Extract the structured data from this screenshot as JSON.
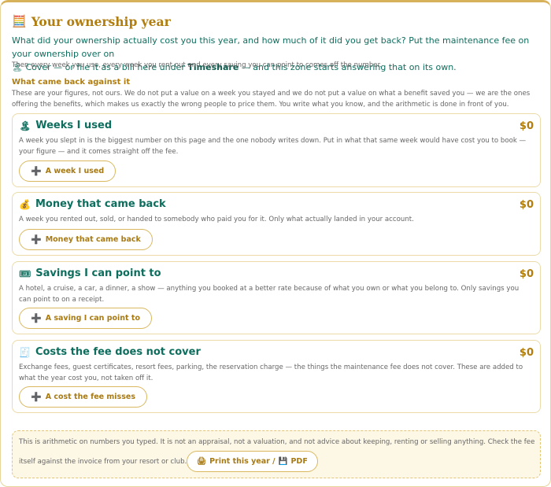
{
  "header": {
    "icon": "abacus-icon",
    "icon_glyph": "🧮",
    "title": "Your ownership year",
    "lead_part1": "What did your ownership actually cost you this year, and how much of it did you get back? Put the maintenance fee on your ownership over on",
    "lead_cover_icon": "🏝",
    "lead_part2": " Cover — or file it as a bill here under ",
    "lead_bold": "Timeshare",
    "lead_part3": " — and this zone starts answering that on its own.",
    "subtext": "Then every week you use, every week you rent out and every saving you can point to comes off the number."
  },
  "section": {
    "heading": "What came back against it",
    "description": "These are your figures, not ours. We do not put a value on a week you stayed and we do not put a value on what a benefit saved you — we are the ones offering the benefits, which makes us exactly the wrong people to price them. You write what you know, and the arithmetic is done in front of you."
  },
  "cards": [
    {
      "icon": "island-icon",
      "icon_glyph": "🏝",
      "title": "Weeks I used",
      "amount": "$0",
      "description": "A week you slept in is the biggest number on this page and the one nobody writes down. Put in what that same week would have cost you to book — your figure — and it comes straight off the fee.",
      "button": "A week I used"
    },
    {
      "icon": "money-bag-icon",
      "icon_glyph": "💰",
      "title": "Money that came back",
      "amount": "$0",
      "description": "A week you rented out, sold, or handed to somebody who paid you for it. Only what actually landed in your account.",
      "button": "Money that came back"
    },
    {
      "icon": "ticket-icon",
      "icon_glyph": "🎟",
      "title": "Savings I can point to",
      "amount": "$0",
      "description": "A hotel, a cruise, a car, a dinner, a show — anything you booked at a better rate because of what you own or what you belong to. Only savings you can point to on a receipt.",
      "button": "A saving I can point to"
    },
    {
      "icon": "receipt-icon",
      "icon_glyph": "🧾",
      "title": "Costs the fee does not cover",
      "amount": "$0",
      "description": "Exchange fees, guest certificates, resort fees, parking, the reservation charge — the things the maintenance fee does not cover. These are added to what the year cost you, not taken off it.",
      "button": "A cost the fee misses"
    }
  ],
  "plus_glyph": "➕",
  "footer": {
    "text_line1": "This is arithmetic on numbers you typed. It is not an appraisal, not a valuation, and not advice about keeping, renting or selling anything. Check the fee",
    "text_line2": "itself against the invoice from your resort or club.",
    "print_icon_glyph": "🖨",
    "print_label": "Print this year / ",
    "pdf_icon_glyph": "💾",
    "pdf_label": "PDF"
  },
  "colors": {
    "accent": "#b07d0e",
    "teal": "#0e6e5e",
    "border": "#ecdba8",
    "footer_bg": "#fdf7e6"
  }
}
